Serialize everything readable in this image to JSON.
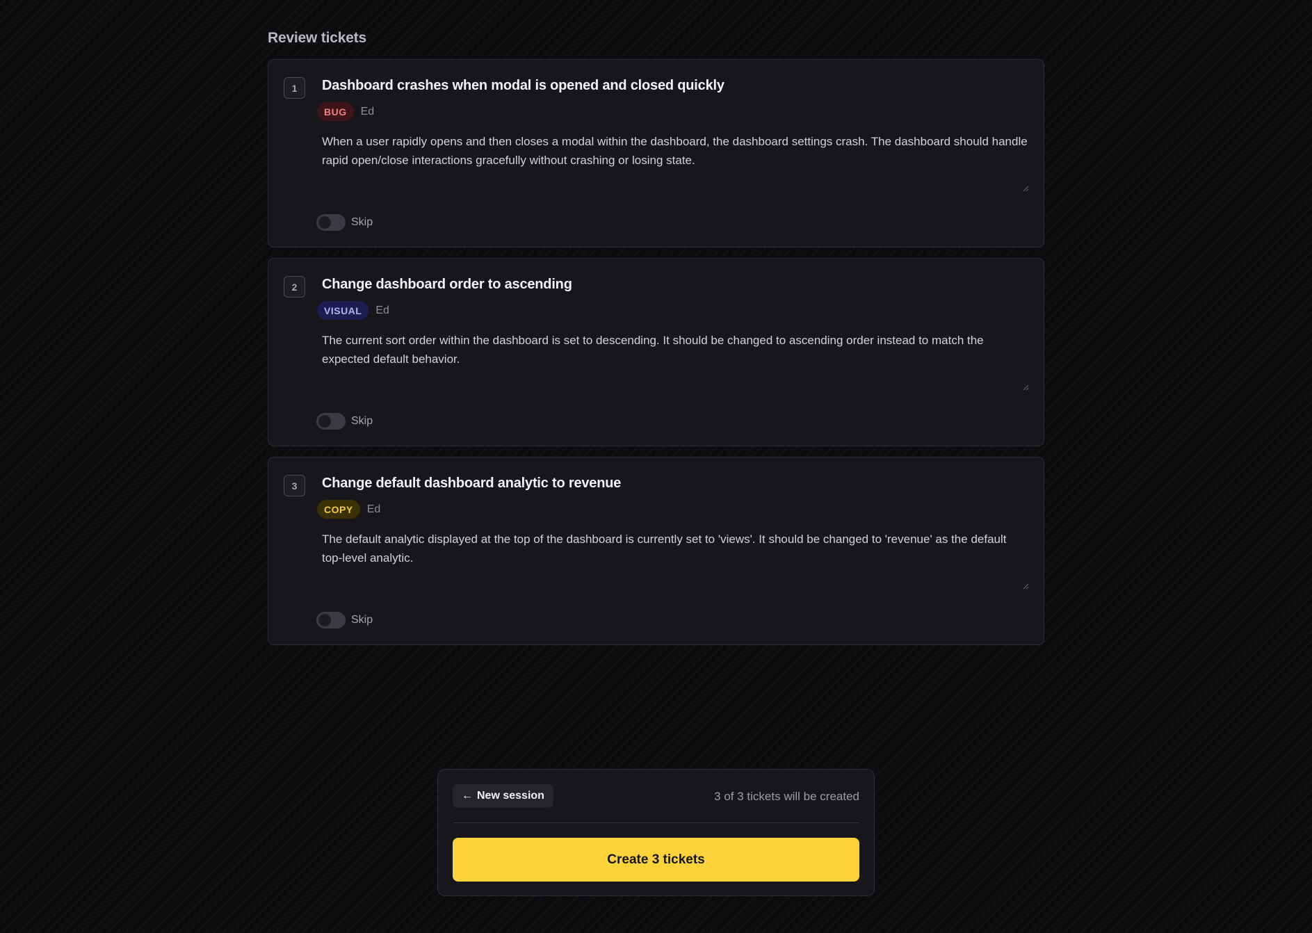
{
  "page": {
    "title": "Review tickets"
  },
  "tickets": [
    {
      "number": "1",
      "title": "Dashboard crashes when modal is opened and closed quickly",
      "tag": "BUG",
      "tag_bg": "#3d1519",
      "tag_fg": "#f07f86",
      "author": "Ed",
      "description": "When a user rapidly opens and then closes a modal within the dashboard, the dashboard settings crash. The dashboard should handle rapid open/close interactions gracefully without crashing or losing state.",
      "skip_label": "Skip",
      "skip_enabled": false
    },
    {
      "number": "2",
      "title": "Change dashboard order to ascending",
      "tag": "VISUAL",
      "tag_bg": "#1e1d52",
      "tag_fg": "#b3b3f3",
      "author": "Ed",
      "description": "The current sort order within the dashboard is set to descending. It should be changed to ascending order instead to match the expected default behavior.",
      "skip_label": "Skip",
      "skip_enabled": false
    },
    {
      "number": "3",
      "title": "Change default dashboard analytic to revenue",
      "tag": "COPY",
      "tag_bg": "#3b3006",
      "tag_fg": "#f4cc3e",
      "author": "Ed",
      "description": "The default analytic displayed at the top of the dashboard is currently set to 'views'. It should be changed to 'revenue' as the default top-level analytic.",
      "skip_label": "Skip",
      "skip_enabled": false
    }
  ],
  "footer": {
    "new_session_arrow": "←",
    "new_session_label": "New session",
    "ticket_count_text": "3 of 3 tickets will be created",
    "create_label": "Create 3 tickets"
  },
  "colors": {
    "accent": "#fdd33b",
    "background": "#0c0c0f",
    "card": "#16161b"
  }
}
